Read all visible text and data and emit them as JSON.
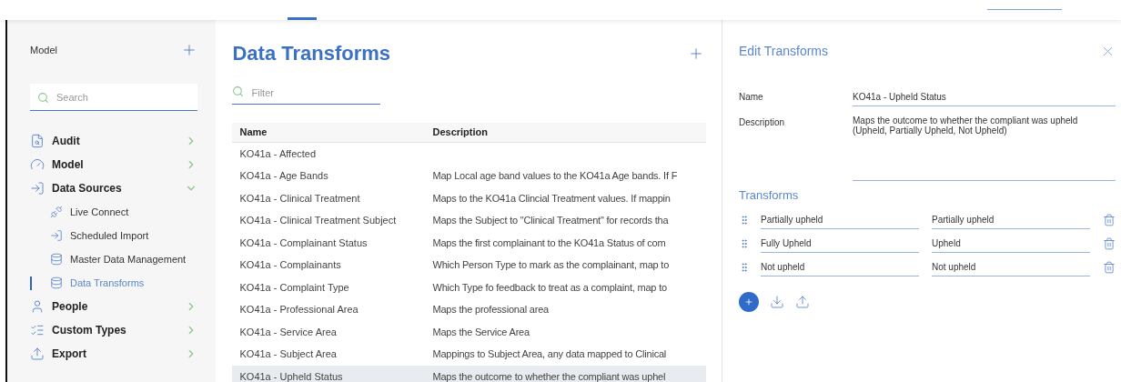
{
  "sidebar": {
    "title": "Model",
    "search": {
      "placeholder": "Search"
    },
    "items": [
      {
        "label": "Audit",
        "expanded": false,
        "selected": false
      },
      {
        "label": "Model",
        "expanded": false,
        "selected": false
      },
      {
        "label": "Data Sources",
        "expanded": true,
        "selected": false,
        "children": [
          {
            "label": "Live Connect",
            "selected": false
          },
          {
            "label": "Scheduled Import",
            "selected": false
          },
          {
            "label": "Master Data Management",
            "selected": false
          },
          {
            "label": "Data Transforms",
            "selected": true
          }
        ]
      },
      {
        "label": "People",
        "expanded": false,
        "selected": false
      },
      {
        "label": "Custom Types",
        "expanded": false,
        "selected": false
      },
      {
        "label": "Export",
        "expanded": false,
        "selected": false
      }
    ]
  },
  "main": {
    "title": "Data Transforms",
    "filter": {
      "placeholder": "Filter"
    },
    "table": {
      "columns": [
        "Name",
        "Description"
      ],
      "rows": [
        {
          "name": "KO41a - Affected",
          "description": "",
          "selected": false
        },
        {
          "name": "KO41a - Age Bands",
          "description": "Map Local age band values to the KO41a Age bands. If F",
          "selected": false
        },
        {
          "name": "KO41a - Clinical Treatment",
          "description": "Maps to the KO41a Clincial Treatment values. If mappin",
          "selected": false
        },
        {
          "name": "KO41a - Clinical Treatment Subject",
          "description": "Maps the Subject to \"Clinical Treatment\" for records tha",
          "selected": false
        },
        {
          "name": "KO41a - Complainant Status",
          "description": "Maps the first complainant to the KO41a Status of com",
          "selected": false
        },
        {
          "name": "KO41a - Complainants",
          "description": "Which Person Type to mark as the complainant, map to",
          "selected": false
        },
        {
          "name": "KO41a - Complaint Type",
          "description": "Which Type fo feedback to treat as a complaint, map to",
          "selected": false
        },
        {
          "name": "KO41a - Professional Area",
          "description": "Maps the professional area",
          "selected": false
        },
        {
          "name": "KO41a - Service Area",
          "description": "Maps the Service Area",
          "selected": false
        },
        {
          "name": "KO41a - Subject Area",
          "description": "Mappings to Subject Area, any data mapped to Clinical",
          "selected": false
        },
        {
          "name": "KO41a - Upheld Status",
          "description": "Maps the outcome to whether the compliant was uphel",
          "selected": true
        }
      ]
    }
  },
  "editor": {
    "title": "Edit Transforms",
    "fields": [
      {
        "label": "Name",
        "value": "KO41a - Upheld Status"
      },
      {
        "label": "Description",
        "value": "Maps the outcome to whether the compliant was upheld (Upheld, Partially Upheld, Not Upheld)"
      }
    ],
    "transforms_title": "Transforms",
    "transforms": [
      {
        "from": "Partially upheld",
        "to": "Partially upheld"
      },
      {
        "from": "Fully Upheld",
        "to": "Upheld"
      },
      {
        "from": "Not upheld",
        "to": "Not upheld"
      }
    ]
  }
}
